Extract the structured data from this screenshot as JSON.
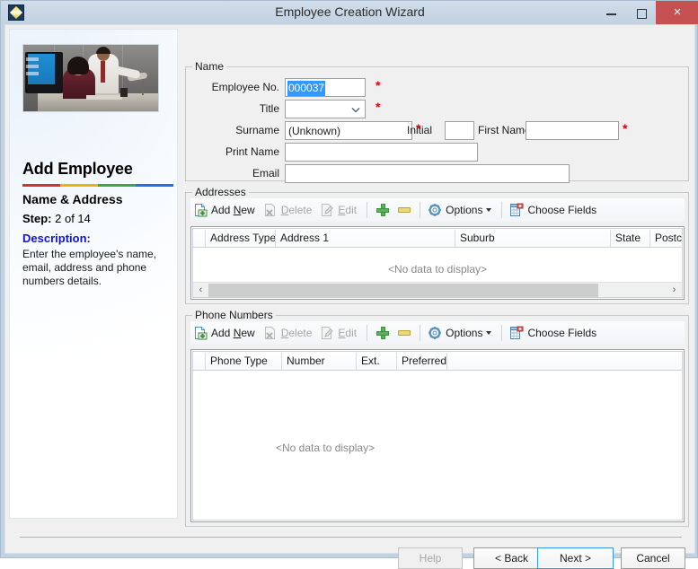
{
  "window": {
    "title": "Employee Creation Wizard",
    "app_icon": "diamond-logo-icon",
    "minimize_label": "Minimize",
    "maximize_label": "Maximize",
    "close_label": "×"
  },
  "sidebar": {
    "image_alt": "two-people-at-computer-photo",
    "heading": "Add Employee",
    "divider_colors": [
      "#d93025",
      "#f2b10a",
      "#36a852",
      "#1a73e8"
    ],
    "step_title": "Name & Address",
    "step_label": "Step:",
    "step_value": "2 of 14",
    "description_heading": "Description:",
    "description_body": "Enter the employee's name, email, address and phone numbers details."
  },
  "name_group": {
    "legend": "Name",
    "fields": {
      "employee_no": {
        "label": "Employee No.",
        "value": "000037",
        "required": "*",
        "selected": true
      },
      "title": {
        "label": "Title",
        "value": "",
        "required": "*",
        "options": []
      },
      "surname": {
        "label": "Surname",
        "value": "(Unknown)",
        "required": "*"
      },
      "initial": {
        "label": "Initial",
        "value": ""
      },
      "first_name": {
        "label": "First Name",
        "value": "",
        "required": "*"
      },
      "print_name": {
        "label": "Print Name",
        "value": ""
      },
      "email": {
        "label": "Email",
        "value": ""
      }
    }
  },
  "addresses": {
    "legend": "Addresses",
    "toolbar": [
      {
        "label": "Add New",
        "icon": "page-add-icon",
        "accel": "N",
        "disabled": false
      },
      {
        "label": "Delete",
        "icon": "page-delete-icon",
        "accel": "D",
        "disabled": true
      },
      {
        "label": "Edit",
        "icon": "page-edit-icon",
        "accel": "E",
        "disabled": true
      },
      {
        "label": "",
        "icon": "plus-icon",
        "disabled": false
      },
      {
        "label": "",
        "icon": "minus-icon",
        "disabled": false
      },
      {
        "label": "Options",
        "icon": "gear-icon",
        "dropdown": true,
        "disabled": false
      },
      {
        "label": "Choose Fields",
        "icon": "table-columns-icon",
        "disabled": false
      }
    ],
    "columns": [
      "Address Type",
      "Address 1",
      "Suburb",
      "State",
      "Postcode"
    ],
    "rows": [],
    "empty_text": "<No data to display>",
    "scrollbar": {
      "left_arrow": "‹",
      "right_arrow": "›",
      "thumb_percent": 85
    }
  },
  "phone_numbers": {
    "legend": "Phone Numbers",
    "toolbar": [
      {
        "label": "Add New",
        "icon": "page-add-icon",
        "accel": "N",
        "disabled": false
      },
      {
        "label": "Delete",
        "icon": "page-delete-icon",
        "accel": "D",
        "disabled": true
      },
      {
        "label": "Edit",
        "icon": "page-edit-icon",
        "accel": "E",
        "disabled": true
      },
      {
        "label": "",
        "icon": "plus-icon",
        "disabled": false
      },
      {
        "label": "",
        "icon": "minus-icon",
        "disabled": false
      },
      {
        "label": "Options",
        "icon": "gear-icon",
        "dropdown": true,
        "disabled": false
      },
      {
        "label": "Choose Fields",
        "icon": "table-columns-icon",
        "disabled": false
      }
    ],
    "columns": [
      "Phone Type",
      "Number",
      "Ext.",
      "Preferred"
    ],
    "rows": [],
    "empty_text": "<No data to display>"
  },
  "footer": {
    "help": "Help",
    "back": "< Back",
    "next": "Next >",
    "cancel": "Cancel"
  }
}
